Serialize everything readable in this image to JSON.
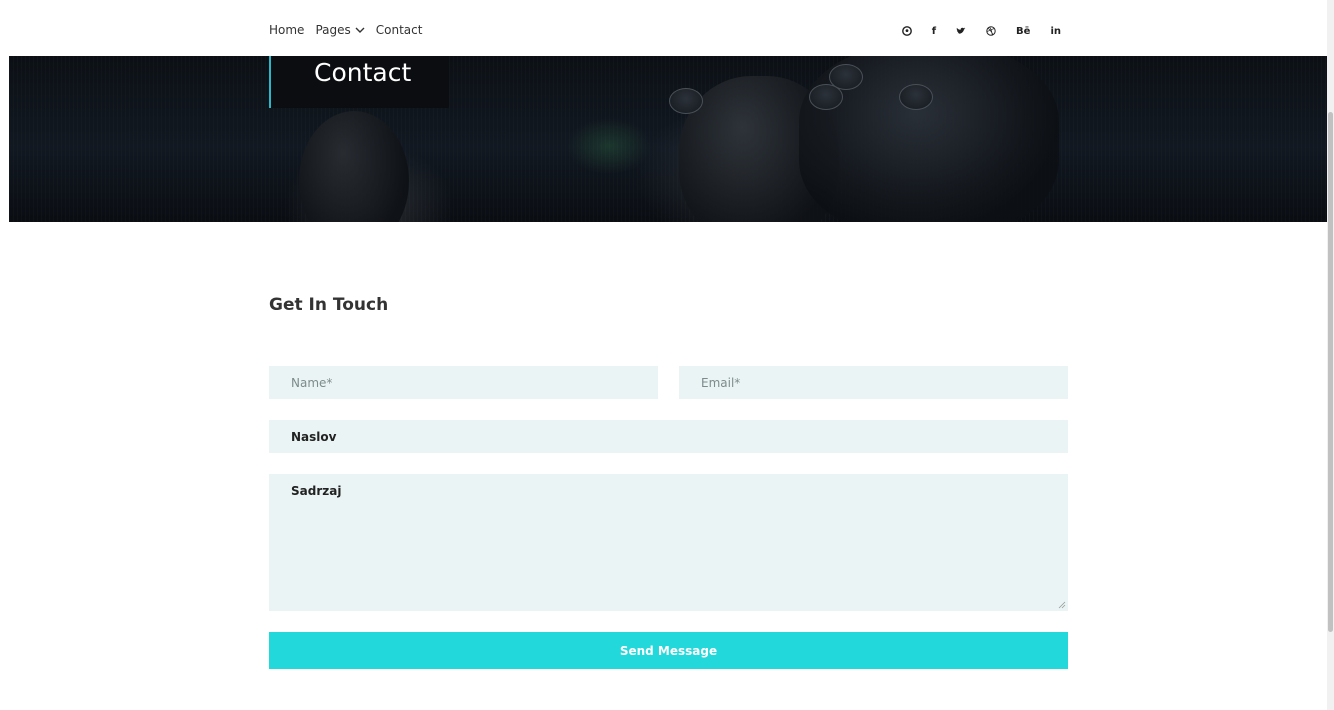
{
  "nav": {
    "items": [
      {
        "label": "Home"
      },
      {
        "label": "Pages",
        "has_dropdown": true
      },
      {
        "label": "Contact"
      }
    ]
  },
  "social": [
    {
      "name": "pinterest-icon",
      "glyph": "℗"
    },
    {
      "name": "facebook-icon",
      "glyph": "f"
    },
    {
      "name": "twitter-icon",
      "glyph": "♥"
    },
    {
      "name": "dribbble-icon",
      "glyph": "⊛"
    },
    {
      "name": "behance-icon",
      "glyph": "Bē"
    },
    {
      "name": "linkedin-icon",
      "glyph": "in"
    }
  ],
  "hero": {
    "title": "Contact"
  },
  "form": {
    "heading": "Get In Touch",
    "name_placeholder": "Name*",
    "email_placeholder": "Email*",
    "subject_value": "Naslov",
    "message_value": "Sadrzaj",
    "submit_label": "Send Message"
  },
  "colors": {
    "accent": "#22d8db",
    "field_bg": "#eaf4f4",
    "hero_border": "#2ab7c7"
  }
}
